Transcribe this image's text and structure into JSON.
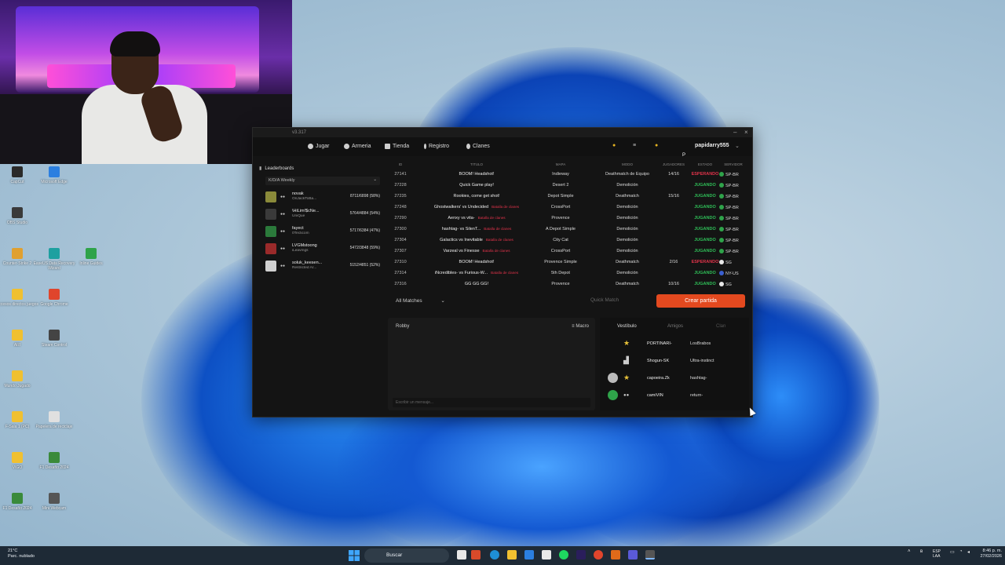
{
  "desktop": {
    "icons": [
      {
        "label": "CapCut",
        "x": 0,
        "y": 0
      },
      {
        "label": "Microsoft Edge",
        "x": 1,
        "y": 0
      },
      {
        "label": "OBS Studio",
        "x": 0,
        "y": 1
      },
      {
        "label": "Counter-Strike 2",
        "x": 0,
        "y": 2
      },
      {
        "label": "EaseUS Data Recovery Wizard",
        "x": 1,
        "y": 2
      },
      {
        "label": "Inline Guides",
        "x": 2,
        "y": 2
      },
      {
        "label": "Accesos directos juegos",
        "x": 0,
        "y": 3
      },
      {
        "label": "Google Chrome",
        "x": 1,
        "y": 3
      },
      {
        "label": "ARI",
        "x": 0,
        "y": 4
      },
      {
        "label": "Steam Control",
        "x": 1,
        "y": 4
      },
      {
        "label": "Mundo Jugado",
        "x": 0,
        "y": 5
      },
      {
        "label": "F-Sala 1 (PC)",
        "x": 0,
        "y": 6
      },
      {
        "label": "Papelera de reciclaje",
        "x": 1,
        "y": 6
      },
      {
        "label": "VIGO",
        "x": 0,
        "y": 7
      },
      {
        "label": "F1 Desafío 2024",
        "x": 1,
        "y": 7
      },
      {
        "label": "F1 Desafío 2024",
        "x": 0,
        "y": 8
      },
      {
        "label": "Mini Webcam",
        "x": 1,
        "y": 8
      }
    ]
  },
  "window": {
    "title": "v3.317",
    "nav": {
      "jugar": "Jugar",
      "armeria": "Armeria",
      "tienda": "Tienda",
      "registro": "Registro",
      "clanes": "Clanes",
      "username": "papidarry555",
      "avatar_letter": "P"
    },
    "leaderboard": {
      "title": "Leaderboards",
      "filter": "K/D/A Weekly",
      "rows": [
        {
          "name": "novak",
          "clan": "OnJackToBa...",
          "stats": "8711/6898 (58%)",
          "color": "#8a8a3a"
        },
        {
          "name": "\\HiLim!$cNe...",
          "clan": "UniQue",
          "stats": "5764/4884 (54%)",
          "color": "#3a3a3a"
        },
        {
          "name": "fayect",
          "clan": "0Tecticom",
          "stats": "5717/6384 (47%)",
          "color": "#2b7a3b"
        },
        {
          "name": "LVGMstoong",
          "clan": "iLeavmgs",
          "stats": "5472/3848 (59%)",
          "color": "#9a2a2a"
        },
        {
          "name": "soluk_keesen...",
          "clan": "Restricted Ar...",
          "stats": "5152/4851 (52%)",
          "color": "#d0d0d0"
        }
      ]
    },
    "table": {
      "headers": {
        "id": "ID",
        "titulo": "TITULO",
        "mapa": "MAPA",
        "modo": "MODO",
        "jugadores": "JUGADORES",
        "estado": "ESTADO",
        "servidor": "SERVIDOR"
      },
      "rows": [
        {
          "id": "27141",
          "title": "BOOM! Headshot!",
          "tag": "",
          "map": "Indieway",
          "mode": "Deathmatch de Equipo",
          "players": "14/16",
          "status": "ESPERANDO",
          "server": "SP-BR",
          "scolor": "#e0334a",
          "fcolor": "#2fa34a"
        },
        {
          "id": "27228",
          "title": "Quick Game play!",
          "tag": "",
          "map": "Desert 2",
          "mode": "Demolición",
          "players": "",
          "status": "JUGANDO",
          "server": "SP-BR",
          "scolor": "#2fbf58",
          "fcolor": "#2fa34a"
        },
        {
          "id": "27235",
          "title": "Rookies, come get shot!",
          "tag": "",
          "map": "Depot Simple",
          "mode": "Deathmatch",
          "players": "15/16",
          "status": "JUGANDO",
          "server": "SP-BR",
          "scolor": "#2fbf58",
          "fcolor": "#2fa34a"
        },
        {
          "id": "27248",
          "title": "Ghostwalkers' vs Undecided",
          "tag": "Batalla de clanes",
          "map": "CrossPort",
          "mode": "Demolición",
          "players": "",
          "status": "JUGANDO",
          "server": "SP-BR",
          "scolor": "#2fbf58",
          "fcolor": "#2fa34a"
        },
        {
          "id": "27290",
          "title": "Aenxy vs vita-",
          "tag": "Batalla de clanes",
          "map": "Provence",
          "mode": "Demolición",
          "players": "",
          "status": "JUGANDO",
          "server": "SP-BR",
          "scolor": "#2fbf58",
          "fcolor": "#2fa34a"
        },
        {
          "id": "27300",
          "title": "hashtag- vs SilenT...",
          "tag": "Batalla de clanes",
          "map": "A Depot Simple",
          "mode": "Demolición",
          "players": "",
          "status": "JUGANDO",
          "server": "SP-BR",
          "scolor": "#2fbf58",
          "fcolor": "#2fa34a"
        },
        {
          "id": "27304",
          "title": "Galactics vs Inevitable",
          "tag": "Batalla de clanes",
          "map": "City Cat",
          "mode": "Demolición",
          "players": "",
          "status": "JUGANDO",
          "server": "SP-BR",
          "scolor": "#2fbf58",
          "fcolor": "#2fa34a"
        },
        {
          "id": "27307",
          "title": "Varzeal vs Finesse",
          "tag": "Batalla de clanes",
          "map": "CrossPort",
          "mode": "Demolición",
          "players": "",
          "status": "JUGANDO",
          "server": "SP-BR",
          "scolor": "#2fbf58",
          "fcolor": "#2fa34a"
        },
        {
          "id": "27310",
          "title": "BOOM! Headshot!",
          "tag": "",
          "map": "Provence Simple",
          "mode": "Deathmatch",
          "players": "2/16",
          "status": "ESPERANDO",
          "server": "SG",
          "scolor": "#e0334a",
          "fcolor": "#e8e8e8"
        },
        {
          "id": "27314",
          "title": "iNcredibles- vs Furious-W...",
          "tag": "Batalla de clanes",
          "map": "5th Depot",
          "mode": "Demolición",
          "players": "",
          "status": "JUGANDO",
          "server": "NY-US",
          "scolor": "#2fbf58",
          "fcolor": "#3a5fd0"
        },
        {
          "id": "27316",
          "title": "GG GG GG!",
          "tag": "",
          "map": "Provence",
          "mode": "Deathmatch",
          "players": "10/16",
          "status": "JUGANDO",
          "server": "SG",
          "scolor": "#2fbf58",
          "fcolor": "#e8e8e8"
        }
      ]
    },
    "controls": {
      "all_matches": "All Matches",
      "quick_match": "Quick Match",
      "create": "Crear partida"
    },
    "chat": {
      "title": "Robby",
      "macro": "Macro",
      "input_placeholder": "Escribir un mensaje..."
    },
    "friends": {
      "tabs": [
        "Vestíbulo",
        "Amigos",
        "Clan"
      ],
      "rows": [
        {
          "name": "PORTINARI-",
          "clan": "LosBrabos"
        },
        {
          "name": "Shogun-SK",
          "clan": "Ultra-instinct"
        },
        {
          "name": "capoeira.Zk",
          "clan": "hashtag-"
        },
        {
          "name": "camiVIN",
          "clan": "return-"
        }
      ]
    }
  },
  "taskbar": {
    "weather_temp": "21°C",
    "weather_desc": "Parc. nublado",
    "search": "Buscar",
    "lang_1": "ESP",
    "lang_2": "LAA",
    "time": "8:46 p. m.",
    "date": "27/02/2026"
  }
}
